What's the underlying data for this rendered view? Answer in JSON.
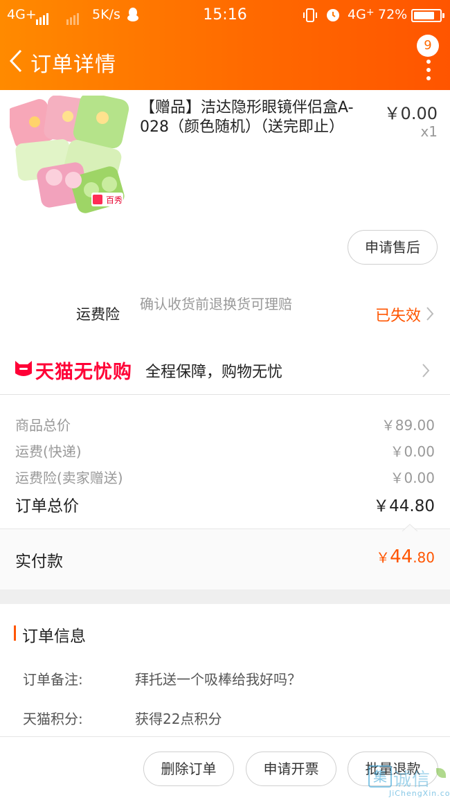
{
  "status_bar": {
    "network_left": "4G+",
    "speed": "5K/s",
    "time": "15:16",
    "network_right": "4G",
    "network_right_suffix": "+",
    "battery": "72%",
    "battery_level": 0.72,
    "icons": [
      "signal-icon",
      "signal-icon",
      "qq-penguin-icon",
      "vibrate-icon",
      "alarm-icon",
      "battery-icon"
    ]
  },
  "nav": {
    "back_icon": "chevron-left-icon",
    "title": "订单详情",
    "badge_count": "9",
    "more_icon": "more-vertical-icon"
  },
  "product": {
    "title": "【赠品】洁达隐形眼镜伴侣盒A-028（颜色随机）（送完即止）",
    "price": "￥0.00",
    "quantity": "x1",
    "image_label": "百秀",
    "after_sale_button": "申请售后"
  },
  "insurance": {
    "label": "运费险",
    "description": "确认收货前退换货可理赔",
    "status": "已失效",
    "status_color": "#ff5500"
  },
  "guarantee": {
    "brand": "天猫无忧购",
    "text": "全程保障，购物无忧",
    "brand_color": "#ff0036"
  },
  "summary": {
    "rows": [
      {
        "label": "商品总价",
        "value": "￥89.00"
      },
      {
        "label": "运费(快递)",
        "value": "￥0.00"
      },
      {
        "label": "运费险(卖家赠送)",
        "value": "￥0.00"
      }
    ],
    "total_label": "订单总价",
    "total_value": "￥44.80",
    "paid_label": "实付款",
    "paid_currency": "￥",
    "paid_integer": "44",
    "paid_decimal": ".80"
  },
  "order_info": {
    "title": "订单信息",
    "rows": [
      {
        "label": "订单备注:",
        "value": "拜托送一个吸棒给我好吗？"
      },
      {
        "label": "天猫积分:",
        "value": "获得22点积分"
      }
    ]
  },
  "actions": {
    "delete": "删除订单",
    "invoice": "申请开票",
    "refund": "批量退款"
  },
  "watermark": {
    "mark": "集",
    "name": "诚信",
    "url": "JiChengXin.com"
  },
  "colors": {
    "header_start": "#ff8a00",
    "header_end": "#ff5500",
    "accent": "#ff5500"
  }
}
